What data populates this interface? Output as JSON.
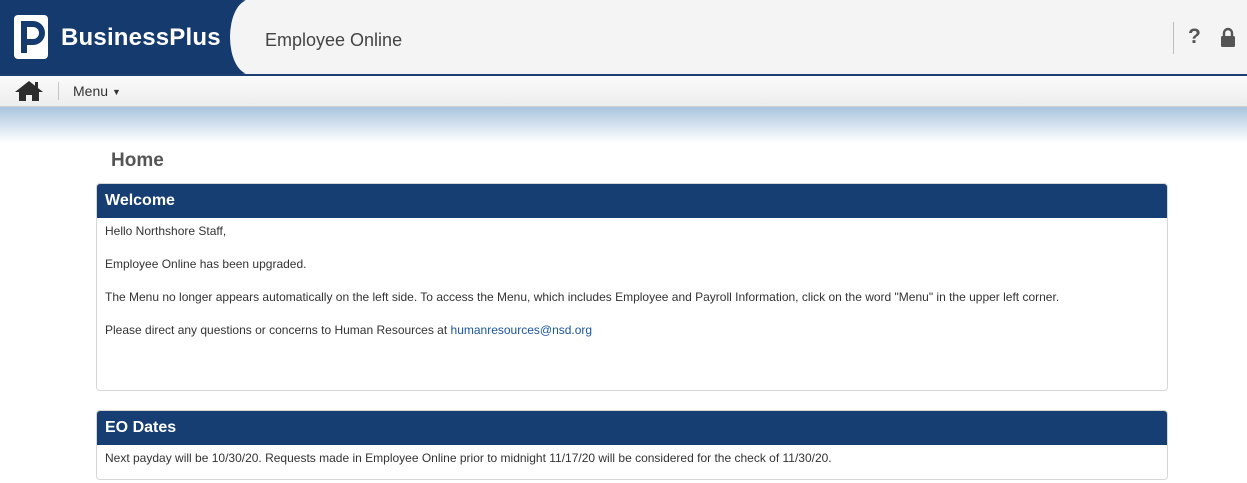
{
  "header": {
    "brand_name": "BusinessPlus",
    "app_title": "Employee Online",
    "help_label": "?",
    "colors": {
      "brand": "#143a6e",
      "panel_header": "#163e72"
    }
  },
  "menubar": {
    "menu_label": "Menu"
  },
  "page": {
    "title": "Home"
  },
  "welcome": {
    "heading": "Welcome",
    "greeting": "Hello Northshore Staff,",
    "upgrade_note": "Employee Online has been upgraded.",
    "menu_note": "The Menu no longer appears automatically on the left side. To access the Menu, which includes Employee and Payroll Information, click on the word \"Menu\" in the upper left corner.",
    "contact_prefix": "Please direct any questions or concerns to Human Resources at ",
    "contact_email": "humanresources@nsd.org"
  },
  "eo_dates": {
    "heading": "EO Dates",
    "payday_note": "Next payday will be 10/30/20. Requests made in Employee Online prior to midnight 11/17/20 will be considered for the check of 11/30/20."
  }
}
